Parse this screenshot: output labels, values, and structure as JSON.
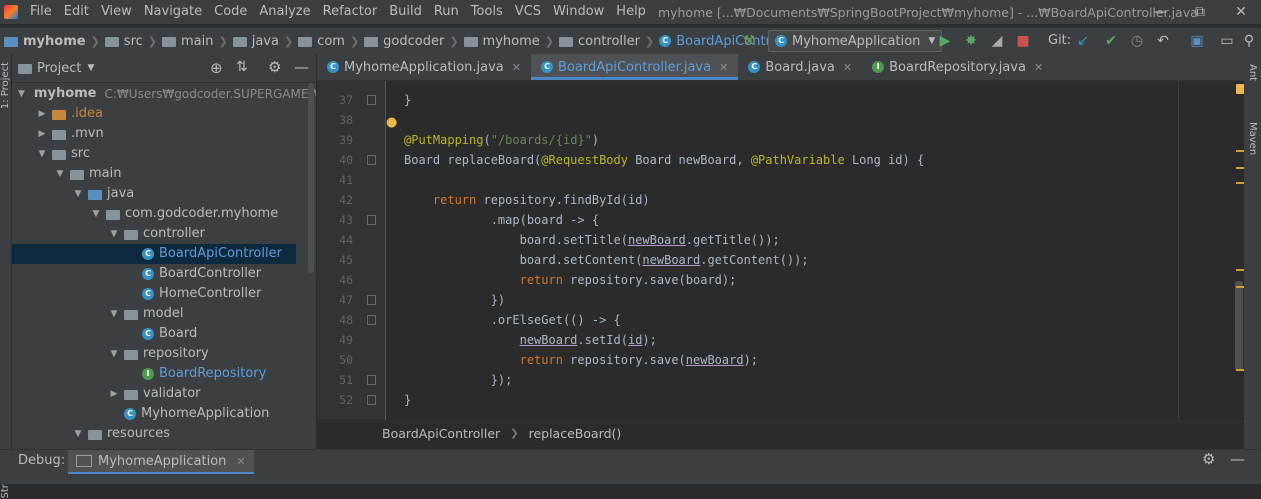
{
  "menu": [
    "File",
    "Edit",
    "View",
    "Navigate",
    "Code",
    "Analyze",
    "Refactor",
    "Build",
    "Run",
    "Tools",
    "VCS",
    "Window",
    "Help"
  ],
  "window_title": "myhome [...₩Documents₩SpringBootProject₩myhome] - ...₩BoardApiController.java",
  "breadcrumbs": [
    "myhome",
    "src",
    "main",
    "java",
    "com",
    "godcoder",
    "myhome",
    "controller",
    "BoardApiController"
  ],
  "run_config": "MyhomeApplication",
  "git_label": "Git:",
  "project_panel": {
    "title": "Project",
    "root_path": "C:₩Users₩godcoder.SUPERGAME₩Dc",
    "tree": [
      {
        "label": "myhome",
        "depth": 0,
        "arrow": "down",
        "icon": "folder-blue",
        "bold": true
      },
      {
        "label": ".idea",
        "depth": 1,
        "arrow": "right",
        "icon": "folder",
        "color": "#c7873c"
      },
      {
        "label": ".mvn",
        "depth": 1,
        "arrow": "right",
        "icon": "folder"
      },
      {
        "label": "src",
        "depth": 1,
        "arrow": "down",
        "icon": "folder"
      },
      {
        "label": "main",
        "depth": 2,
        "arrow": "down",
        "icon": "folder"
      },
      {
        "label": "java",
        "depth": 3,
        "arrow": "down",
        "icon": "folder-blue"
      },
      {
        "label": "com.godcoder.myhome",
        "depth": 4,
        "arrow": "down",
        "icon": "folder"
      },
      {
        "label": "controller",
        "depth": 5,
        "arrow": "down",
        "icon": "folder"
      },
      {
        "label": "BoardApiController",
        "depth": 6,
        "arrow": "",
        "icon": "class",
        "color": "#5f9dd8",
        "selected": true
      },
      {
        "label": "BoardController",
        "depth": 6,
        "arrow": "",
        "icon": "class"
      },
      {
        "label": "HomeController",
        "depth": 6,
        "arrow": "",
        "icon": "class"
      },
      {
        "label": "model",
        "depth": 5,
        "arrow": "down",
        "icon": "folder"
      },
      {
        "label": "Board",
        "depth": 6,
        "arrow": "",
        "icon": "class"
      },
      {
        "label": "repository",
        "depth": 5,
        "arrow": "down",
        "icon": "folder"
      },
      {
        "label": "BoardRepository",
        "depth": 6,
        "arrow": "",
        "icon": "interface",
        "color": "#5f9dd8"
      },
      {
        "label": "validator",
        "depth": 5,
        "arrow": "right",
        "icon": "folder"
      },
      {
        "label": "MyhomeApplication",
        "depth": 5,
        "arrow": "",
        "icon": "class"
      },
      {
        "label": "resources",
        "depth": 3,
        "arrow": "down",
        "icon": "folder"
      }
    ]
  },
  "tabs": [
    {
      "label": "MyhomeApplication.java",
      "icon": "class",
      "active": false
    },
    {
      "label": "BoardApiController.java",
      "icon": "class",
      "active": true
    },
    {
      "label": "Board.java",
      "icon": "class",
      "active": false
    },
    {
      "label": "BoardRepository.java",
      "icon": "interface",
      "active": false
    }
  ],
  "code_lines": [
    {
      "n": "37",
      "html": "}"
    },
    {
      "n": "38",
      "html": ""
    },
    {
      "n": "39",
      "html": "<span class=\"an\">@PutMapping</span>(<span class=\"st\">\"/boards/{id}\"</span>)"
    },
    {
      "n": "40",
      "html": "Board replaceBoard(<span class=\"an\">@RequestBody</span> Board newBoard, <span class=\"an\">@PathVariable</span> Long id) {"
    },
    {
      "n": "41",
      "html": ""
    },
    {
      "n": "42",
      "html": "    <span class=\"kw\">return</span> repository.findById(id)"
    },
    {
      "n": "43",
      "html": "            .map(board -> {"
    },
    {
      "n": "44",
      "html": "                board.setTitle(<span class=\"ul\">newBoard</span>.getTitle());"
    },
    {
      "n": "45",
      "html": "                board.setContent(<span class=\"ul\">newBoard</span>.getContent());"
    },
    {
      "n": "46",
      "html": "                <span class=\"kw\">return</span> repository.save(board);"
    },
    {
      "n": "47",
      "html": "            })"
    },
    {
      "n": "48",
      "html": "            .orElseGet(() -> {"
    },
    {
      "n": "49",
      "html": "                <span class=\"ul\">newBoard</span>.setId(<span class=\"ul\">id</span>);"
    },
    {
      "n": "50",
      "html": "                <span class=\"kw\">return</span> repository.save(<span class=\"ul\">newBoard</span>);"
    },
    {
      "n": "51",
      "html": "            });"
    },
    {
      "n": "52",
      "html": "}"
    }
  ],
  "editor_breadcrumb": [
    "BoardApiController",
    "replaceBoard()"
  ],
  "debug": {
    "label": "Debug:",
    "config": "MyhomeApplication"
  },
  "side_labels": {
    "left_top": "1: Project",
    "left_bottom": "Structure",
    "right_top": "Ant",
    "right_mid": "Maven"
  }
}
